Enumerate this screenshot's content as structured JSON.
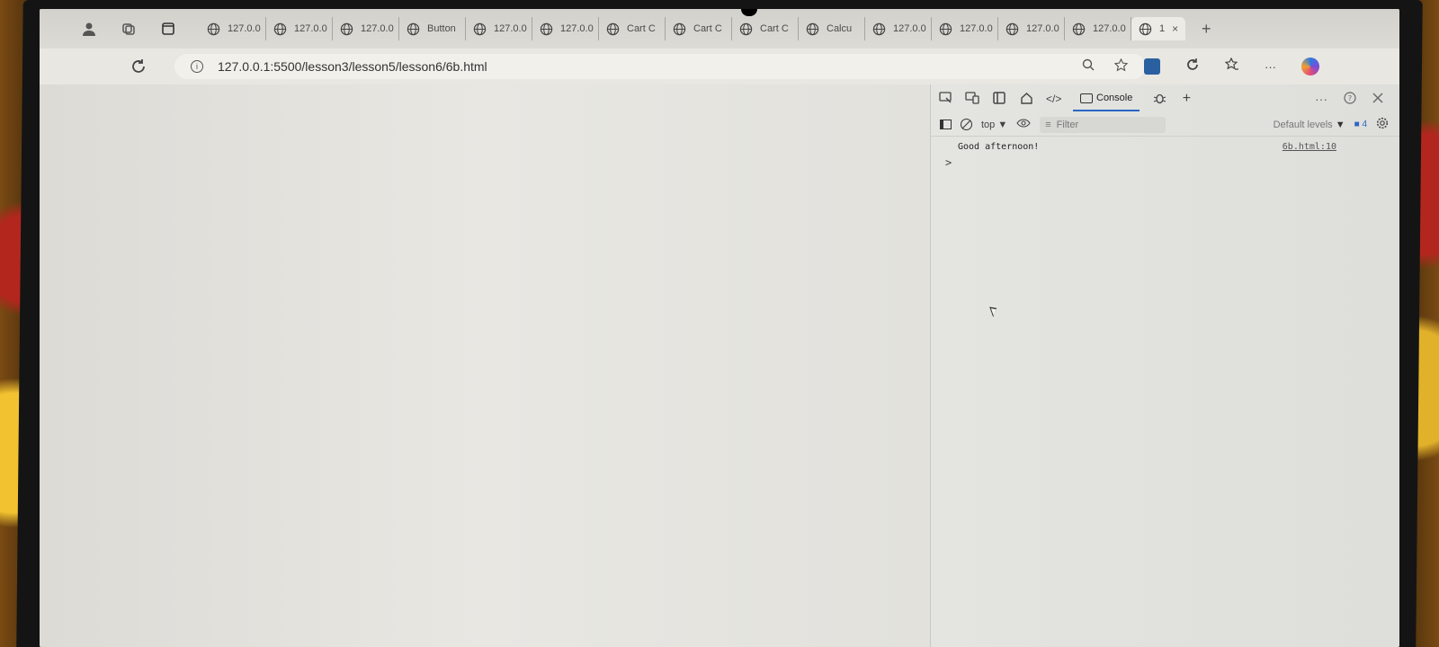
{
  "tabs": [
    {
      "label": "127.0.0"
    },
    {
      "label": "127.0.0"
    },
    {
      "label": "127.0.0"
    },
    {
      "label": "Button"
    },
    {
      "label": "127.0.0"
    },
    {
      "label": "127.0.0"
    },
    {
      "label": "Cart C"
    },
    {
      "label": "Cart C"
    },
    {
      "label": "Cart C"
    },
    {
      "label": "Calcu"
    },
    {
      "label": "127.0.0"
    },
    {
      "label": "127.0.0"
    },
    {
      "label": "127.0.0"
    },
    {
      "label": "127.0.0"
    }
  ],
  "active_tab": {
    "label": "1",
    "close": "×"
  },
  "new_tab": "+",
  "address": {
    "url": "127.0.0.1:5500/lesson3/lesson5/lesson6/6b.html"
  },
  "devtools": {
    "console_tab": "Console",
    "context": "top",
    "filter_placeholder": "Filter",
    "levels": "Default levels",
    "issues_count": "4",
    "more": "···",
    "add": "+"
  },
  "console_log": [
    {
      "message": "Good afternoon!",
      "source": "6b.html:10"
    }
  ],
  "prompt_symbol": ">"
}
